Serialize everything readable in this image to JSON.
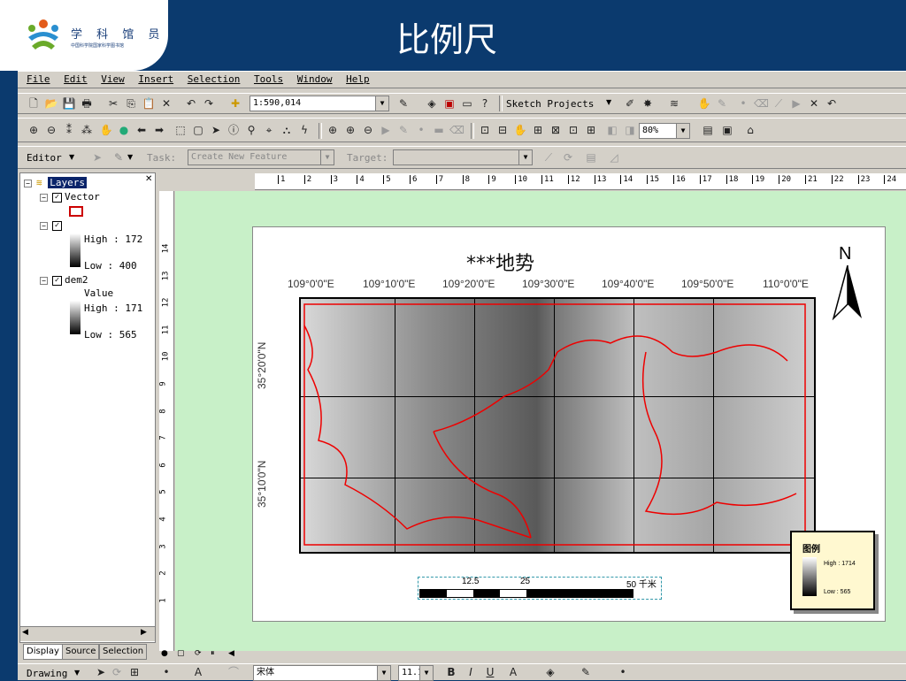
{
  "slide": {
    "logo_title": "学 科 馆 员",
    "logo_subtitle": "中国科学院国家科学图书馆",
    "title": "比例尺"
  },
  "menu": [
    "File",
    "Edit",
    "View",
    "Insert",
    "Selection",
    "Tools",
    "Window",
    "Help"
  ],
  "toolbar1": {
    "scale_value": "1:590,014",
    "sketch_label": "Sketch Projects"
  },
  "toolbar2": {
    "zoom_value": "80%"
  },
  "editor_bar": {
    "editor_label": "Editor",
    "task_label": "Task:",
    "task_value": "Create New Feature",
    "target_label": "Target:"
  },
  "toc": {
    "root": "Layers",
    "vector": "Vector",
    "layer2_high": "High : 172",
    "layer2_low": "Low : 400",
    "dem2": "dem2",
    "dem2_value": "Value",
    "dem2_high": "High : 171",
    "dem2_low": "Low : 565",
    "tabs": [
      "Display",
      "Source",
      "Selection"
    ]
  },
  "ruler_h": [
    "1",
    "2",
    "3",
    "4",
    "5",
    "6",
    "7",
    "8",
    "9",
    "10",
    "11",
    "12",
    "13",
    "14",
    "15",
    "16",
    "17",
    "18",
    "19",
    "20",
    "21",
    "22",
    "23",
    "24"
  ],
  "ruler_v": [
    "14",
    "13",
    "12",
    "11",
    "10",
    "9",
    "8",
    "7",
    "6",
    "5",
    "4",
    "3",
    "2",
    "1"
  ],
  "map": {
    "title": "***地势",
    "north": "N",
    "lon_labels": [
      "109°0'0\"E",
      "109°10'0\"E",
      "109°20'0\"E",
      "109°30'0\"E",
      "109°40'0\"E",
      "109°50'0\"E",
      "110°0'0\"E"
    ],
    "lat_labels": [
      "35°20'0\"N",
      "35°10'0\"N"
    ],
    "scale_labels": [
      "12.5",
      "25",
      "50 千米"
    ],
    "legend_title": "图例",
    "legend_high": "High : 1714",
    "legend_low": "Low : 565"
  },
  "draw_bar": {
    "drawing_label": "Drawing",
    "font_value": "宋体",
    "size_value": "11.1"
  }
}
